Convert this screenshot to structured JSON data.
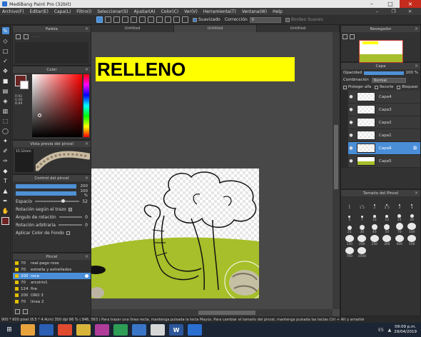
{
  "window": {
    "title": "MediBang Paint Pro (32bit)"
  },
  "menu": [
    "Archivo(F)",
    "Editar(E)",
    "Capa(L)",
    "Filtro(I)",
    "Seleccionar(S)",
    "Ajustar(A)",
    "Color(C)",
    "Ver(V)",
    "Herramienta(T)",
    "Ventana(W)",
    "Help"
  ],
  "toolbar": {
    "smoothing_label": "Suavizado",
    "correction_label": "Corrección",
    "correction_value": "0",
    "border_label": "Bordeo Suaves"
  },
  "tabs": [
    "Untitled",
    "Untitled",
    "Untitled"
  ],
  "panels": {
    "palette": "Paleta",
    "color": "Color",
    "color_values": [
      "R:92",
      "G:92",
      "B:89"
    ],
    "brush_preview": "Vista previa del pincel",
    "brush_preview_size": "15.52mm",
    "brush_control": "Control del pincel",
    "brush_size_value": "200",
    "opacity_value": "100 %",
    "brush_settings": [
      {
        "label": "Espacio",
        "value": "52"
      },
      {
        "label": "Rotación según el trazo",
        "value": ""
      },
      {
        "label": "Ángulo de rotación",
        "value": "0"
      },
      {
        "label": "Rotación arbitraria",
        "value": "0"
      },
      {
        "label": "Aplicar Color de Fondo",
        "value": ""
      }
    ],
    "brush_list_title": "Pincel",
    "brush_list": [
      {
        "size": "70",
        "name": "real-pago rose"
      },
      {
        "size": "70",
        "name": "estrella y estrellados"
      },
      {
        "size": "200",
        "name": "roca",
        "selected": true
      },
      {
        "size": "70",
        "name": "arcoiris1"
      },
      {
        "size": "124",
        "name": "fire"
      },
      {
        "size": "200",
        "name": "ORO 3"
      },
      {
        "size": "70",
        "name": "linea 2"
      }
    ],
    "navigator": "Navegador",
    "layer": "Capa",
    "layer_opacity_label": "Opacidad",
    "layer_opacity_value": "100 %",
    "blend_label": "Combinación",
    "blend_value": "Normal",
    "protect_alpha": "Proteger alfa",
    "clipping": "Recorte",
    "lock": "Bloquear",
    "layers": [
      {
        "name": "Capa4",
        "thumb": "checker"
      },
      {
        "name": "Capa3",
        "thumb": "checker"
      },
      {
        "name": "Capa2",
        "thumb": "checker"
      },
      {
        "name": "Capa1",
        "thumb": "checker"
      },
      {
        "name": "Capa6",
        "thumb": "checker",
        "selected": true
      },
      {
        "name": "Capa5",
        "thumb": "landscape"
      }
    ],
    "brush_size_title": "Tamaño del Pincel",
    "brush_sizes": [
      "1",
      "1.5",
      "2",
      "2.5",
      "3",
      "4",
      "5",
      "7",
      "10",
      "12",
      "15",
      "20",
      "25",
      "30",
      "40",
      "50",
      "70",
      "100",
      "150",
      "200",
      "250",
      "300",
      "400",
      "500",
      "700",
      "1000"
    ]
  },
  "canvas": {
    "banner": "RELLENO",
    "banner_color": "#ffff00"
  },
  "status": {
    "text": "900 * 600 pixel  (8.5 * 4.4cm)  350 dpi  86 %  ( 846, 563 )  Para trazar una linea recta, mantenga pulsada la tecla Mayús. Para cambiar el tamaño del pincel, mantenga pulsada las teclas Ctrl + Alt y arrastre"
  },
  "taskbar": {
    "lang": "ES",
    "time": "09:09 p.m.",
    "date": "29/04/2019"
  },
  "colors": {
    "accent": "#4a8ed8",
    "grass": "#a6bf2a",
    "foreground_color": "#6b2323"
  }
}
